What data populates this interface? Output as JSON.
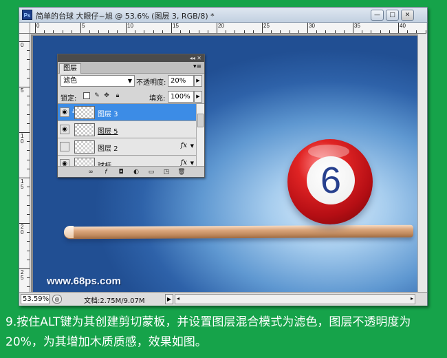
{
  "window": {
    "title": "简单的台球  大眼仔~旭 @ 53.6% (图层 3, RGB/8) *",
    "app_icon": "Ps",
    "controls": {
      "minimize": "—",
      "maximize": "□",
      "close": "✕"
    }
  },
  "rulers": {
    "top_labels": [
      "0",
      "5",
      "10",
      "15",
      "20",
      "25",
      "30",
      "35",
      "40"
    ],
    "left_labels": [
      "0",
      "5",
      "1\n0",
      "1\n5",
      "2\n0",
      "2\n5"
    ]
  },
  "canvas": {
    "ball_number": "6",
    "watermark": "www.68ps.com"
  },
  "status": {
    "zoom": "53.59%",
    "doc_info": "文档:2.75M/9.07M"
  },
  "layers_panel": {
    "tab": "图层",
    "blend_mode": "滤色",
    "opacity_label": "不透明度:",
    "opacity_value": "20%",
    "lock_label": "锁定:",
    "fill_label": "填充:",
    "fill_value": "100%",
    "layers": [
      {
        "name": "图层 3",
        "selected": true,
        "visible": true,
        "fx": ""
      },
      {
        "name": "图层 5",
        "selected": false,
        "visible": true,
        "fx": ""
      },
      {
        "name": "图层 2",
        "selected": false,
        "visible": false,
        "fx": "fx"
      },
      {
        "name": "球杆",
        "selected": false,
        "visible": true,
        "fx": "fx"
      }
    ]
  },
  "caption": "9.按住ALT键为其创建剪切蒙板，并设置图层混合模式为滤色，图层不透明度为20%，为其增加木质质感，效果如图。"
}
